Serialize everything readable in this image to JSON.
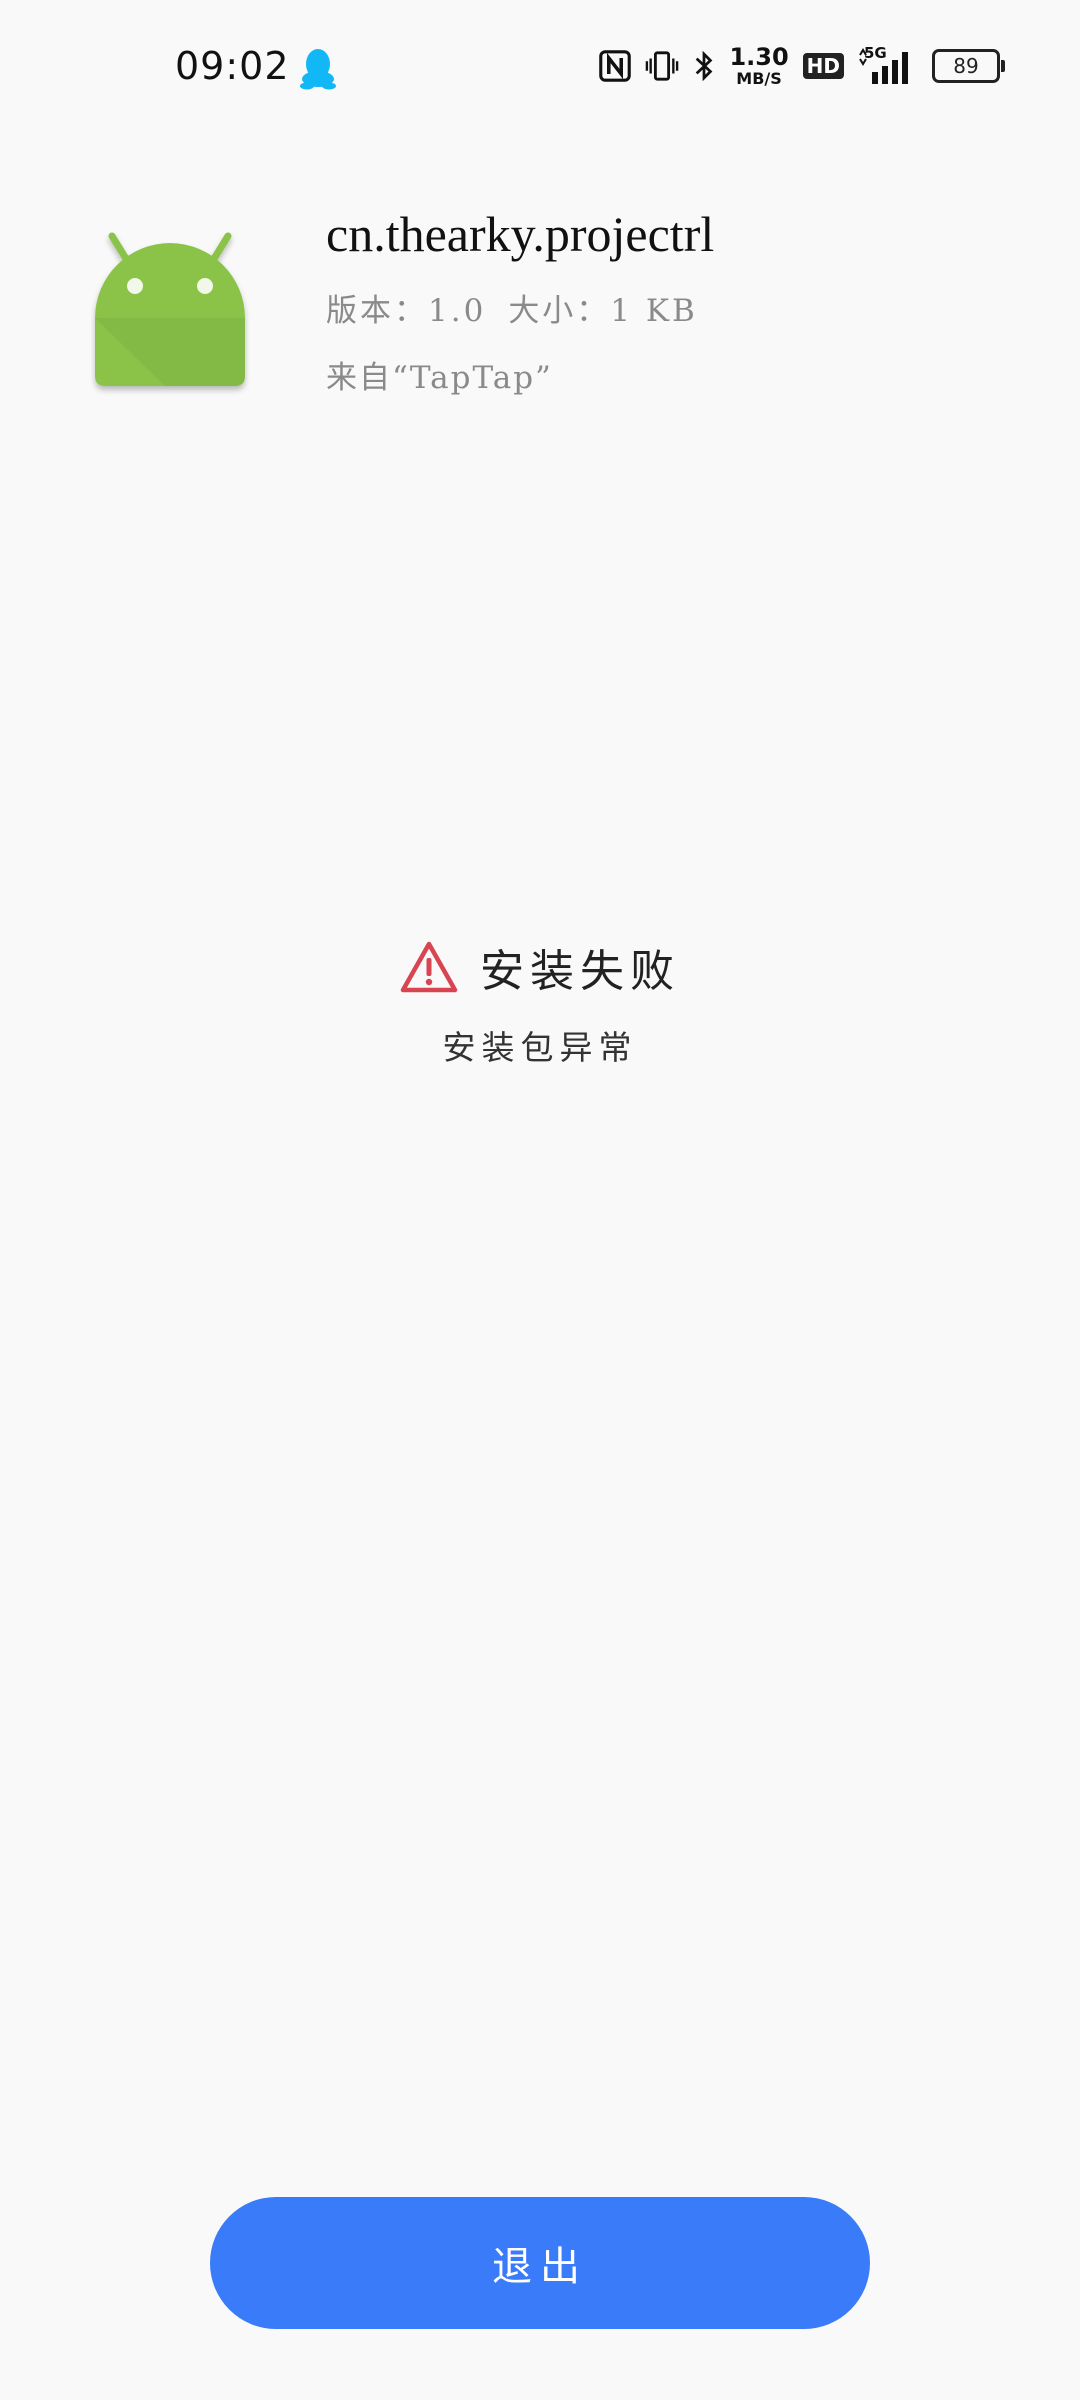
{
  "status_bar": {
    "time": "09:02",
    "net_speed_value": "1.30",
    "net_speed_unit": "MB/S",
    "hd_label": "HD",
    "network_label": "5G",
    "battery_level": "89",
    "icons": [
      "qq-icon",
      "nfc-icon",
      "vibrate-icon",
      "bluetooth-icon",
      "hd-icon",
      "signal-icon",
      "battery-icon"
    ]
  },
  "app": {
    "package_name": "cn.thearky.projectrl",
    "version_text": "版本：1.0",
    "size_text": "大小：1 KB",
    "source_text": "来自“TapTap”",
    "icon": "android-robot-icon"
  },
  "result": {
    "icon": "warning-triangle-icon",
    "title": "安装失败",
    "subtitle": "安装包异常"
  },
  "actions": {
    "exit_label": "退出"
  },
  "colors": {
    "accent": "#3a7bf9",
    "warning": "#d94452",
    "android_green": "#8bc34a",
    "qq_blue": "#12b7f5",
    "background": "#f9f9f9"
  }
}
